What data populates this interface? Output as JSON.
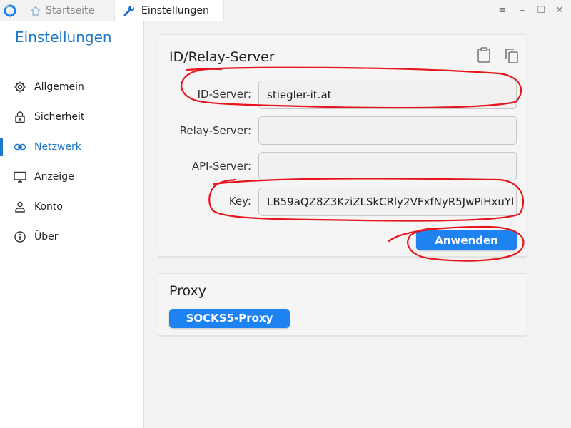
{
  "titlebar": {
    "tabs": [
      {
        "label": "Startseite",
        "icon": "home-icon"
      },
      {
        "label": "Einstellungen",
        "icon": "wrench-icon"
      }
    ],
    "controls": {
      "menu": "≡",
      "minimize": "–",
      "maximize": "☐",
      "close": "✕"
    }
  },
  "sidebar": {
    "title": "Einstellungen",
    "items": [
      {
        "label": "Allgemein",
        "icon": "gear-icon"
      },
      {
        "label": "Sicherheit",
        "icon": "lock-icon"
      },
      {
        "label": "Netzwerk",
        "icon": "link-icon",
        "active": true
      },
      {
        "label": "Anzeige",
        "icon": "monitor-icon"
      },
      {
        "label": "Konto",
        "icon": "user-icon"
      },
      {
        "label": "Über",
        "icon": "info-icon"
      }
    ]
  },
  "server_card": {
    "title": "ID/Relay-Server",
    "id_server_label": "ID-Server:",
    "id_server_value": "stiegler-it.at",
    "relay_server_label": "Relay-Server:",
    "relay_server_value": "",
    "api_server_label": "API-Server:",
    "api_server_value": "",
    "key_label": "Key:",
    "key_value": "LB59aQZ8Z3KziZLSkCRly2VFxfNyR5JwPiHxuYl",
    "apply_label": "Anwenden"
  },
  "proxy_card": {
    "title": "Proxy",
    "socks_label": "SOCKS5-Proxy"
  },
  "colors": {
    "accent": "#1f78c9",
    "button": "#1e82f0",
    "annotation": "#e8141b"
  }
}
